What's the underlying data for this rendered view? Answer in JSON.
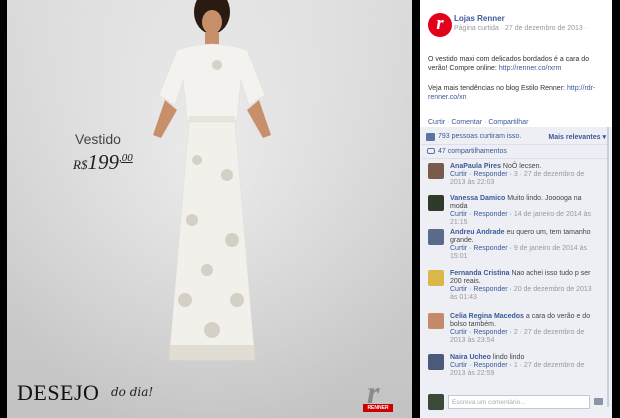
{
  "photo": {
    "caption_product": "Vestido",
    "caption_currency": "R$",
    "caption_price": "199",
    "caption_cents": ",00",
    "brand_main": "DESEJO",
    "brand_script": "do dia!",
    "logo_badge": "RENNER"
  },
  "post": {
    "page_name": "Lojas Renner",
    "page_meta": "Página curtida · 27 de dezembro de 2013 ·",
    "text": "O vestido maxi com delicados bordados é a cara do verão! Compre online:",
    "text_link": "http://renner.co/rxrm",
    "text2": "Veja mais tendências no blog Estilo Renner:",
    "text2_link": "http://rdr-renner.co/xn",
    "actions": [
      "Curtir",
      "Comentar",
      "Compartilhar"
    ]
  },
  "engagement": {
    "likes": "793 pessoas curtiram isso.",
    "relevance": "Mais relevantes ▾",
    "shares": "47 compartilhamentos"
  },
  "comments": [
    {
      "author": "AnaPaula Pires",
      "text": "NoÔ lecsen.",
      "meta_actions": "Curtir · Responder ·",
      "meta_tail": "3 · 27 de dezembro de 2013 às 22:03",
      "avatar_color": "#7a5a4a"
    },
    {
      "author": "Vanessa Damico",
      "text": "Muito lindo. Jooooga na moda",
      "meta_actions": "Curtir · Responder ·",
      "meta_tail": "14 de janeiro de 2014 às 21:15",
      "avatar_color": "#2f3b2a"
    },
    {
      "author": "Andreu Andrade",
      "text": "eu quero um, tem tamanho grande.",
      "meta_actions": "Curtir · Responder ·",
      "meta_tail": "9 de janeiro de 2014 às 15:01",
      "avatar_color": "#5a6a8a"
    },
    {
      "author": "Fernanda Cristina",
      "text": "Nao achei isso tudo p ser 200 reais.",
      "meta_actions": "Curtir · Responder ·",
      "meta_tail": "20 de dezembro de 2013 às 01:43",
      "avatar_color": "#d8b84a"
    },
    {
      "author": "Celia Regina Macedos",
      "text": "a cara do verão e do bolso também.",
      "meta_actions": "Curtir · Responder ·",
      "meta_tail": "2 · 27 de dezembro de 2013 às 23:54",
      "avatar_color": "#c48a6a"
    },
    {
      "author": "Naira Ucheo",
      "text": "lindo lindo",
      "meta_actions": "Curtir · Responder ·",
      "meta_tail": "1 · 27 de dezembro de 2013 às 22:59",
      "avatar_color": "#4a5a7a"
    }
  ],
  "composer": {
    "placeholder": "Escreva um comentário..."
  }
}
